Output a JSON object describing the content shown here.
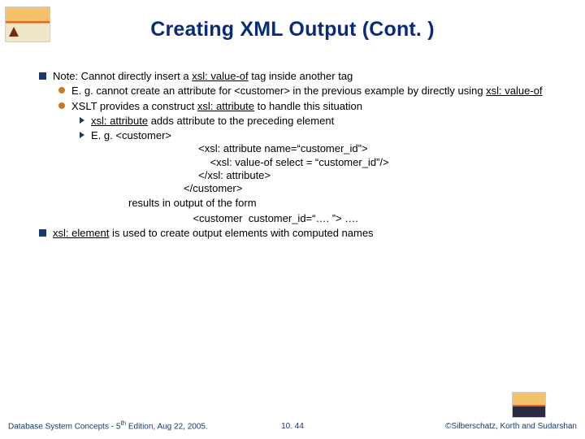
{
  "title": "Creating XML Output (Cont. )",
  "b1_pre": "Note: Cannot directly insert a ",
  "b1_u": "xsl: value-of",
  "b1_post": " tag inside another tag",
  "b1a_pre": "E. g. cannot create an attribute for <customer> in the previous example by directly using ",
  "b1a_u": "xsl: value-of",
  "b1b_pre": "XSLT provides a construct  ",
  "b1b_u": "xsl: attribute",
  "b1b_post": " to handle this situation",
  "b1b_i_pre": "",
  "b1b_i_u": "xsl: attribute",
  "b1b_i_post": " adds attribute to the preceding element",
  "b1b_ii": "E. g.  <customer>",
  "code1": "          <xsl: attribute name=“customer_id”>",
  "code2": "              <xsl: value-of select = “customer_id”/>",
  "code3": "          </xsl: attribute>",
  "code4": "     </customer>",
  "result_label": "results in output of the form",
  "result_line": "                      <customer  customer_id=“…. ”> ….",
  "b2_u": "xsl: element",
  "b2_post": " is used to create output elements with computed names",
  "footer_left_a": "Database System Concepts - 5",
  "footer_left_sup": "th",
  "footer_left_b": " Edition, Aug 22, 2005.",
  "footer_mid": "10. 44",
  "footer_right": "©Silberschatz, Korth and Sudarshan"
}
